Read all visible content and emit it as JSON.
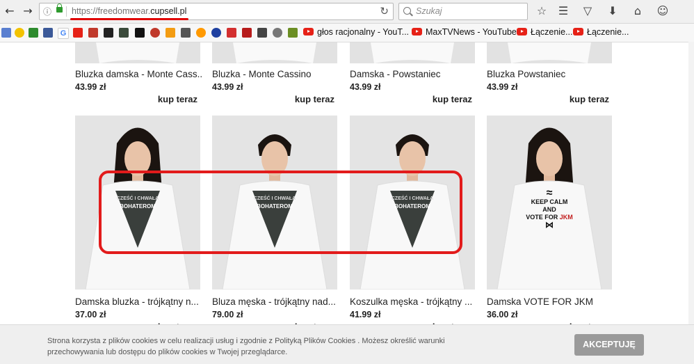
{
  "browser": {
    "url_prefix": "https://freedomwear.",
    "url_domain": "cupsell.pl",
    "search_placeholder": "Szukaj",
    "icons": [
      "back-icon",
      "forward-icon",
      "info-icon",
      "lock-icon",
      "reload-icon",
      "search-icon",
      "star-icon",
      "reading-list-icon",
      "pocket-icon",
      "download-icon",
      "home-icon",
      "chat-icon"
    ]
  },
  "bookmarks": [
    {
      "label": "głos racjonalny - YouT..."
    },
    {
      "label": "MaxTVNews - YouTube"
    },
    {
      "label": "Łączenie..."
    },
    {
      "label": "Łączenie..."
    }
  ],
  "products_top": [
    {
      "name": "Bluzka damska - Monte Cass...",
      "price": "43.99 zł",
      "buy": "kup teraz"
    },
    {
      "name": "Bluzka - Monte Cassino",
      "price": "43.99 zł",
      "buy": "kup teraz"
    },
    {
      "name": "Damska - Powstaniec",
      "price": "43.99 zł",
      "buy": "kup teraz"
    },
    {
      "name": "Bluzka Powstaniec",
      "price": "43.99 zł",
      "buy": "kup teraz"
    }
  ],
  "products_bottom": [
    {
      "name": "Damska bluzka - trójkątny n...",
      "price": "37.00 zł",
      "buy": "kup teraz",
      "print": "triangle",
      "print_text": "CZEŚĆ I CHWAŁA BOHATEROM"
    },
    {
      "name": "Bluza męska - trójkątny nad...",
      "price": "79.00 zł",
      "buy": "kup teraz",
      "print": "triangle",
      "print_text": "CZEŚĆ I CHWAŁA BOHATEROM"
    },
    {
      "name": "Koszulka męska - trójkątny ...",
      "price": "41.99 zł",
      "buy": "kup teraz",
      "print": "triangle",
      "print_text": "CZEŚĆ I CHWAŁA BOHATEROM"
    },
    {
      "name": "Damska VOTE FOR JKM",
      "price": "36.00 zł",
      "buy": "kup teraz",
      "print": "jkm",
      "print_lines": [
        "KEEP CALM",
        "AND",
        "VOTE FOR "
      ],
      "print_accent": "JKM"
    }
  ],
  "cookie": {
    "text": "Strona korzysta z plików cookies w celu realizacji usług i zgodnie z Polityką Plików Cookies . Możesz określić warunki przechowywania lub dostępu do plików cookies w Twojej przeglądarce.",
    "accept_label": "AKCEPTUJĘ"
  },
  "colors": {
    "highlight": "#e21b1b",
    "accent_red": "#e00000",
    "accept_bg": "#9a9a9a"
  }
}
